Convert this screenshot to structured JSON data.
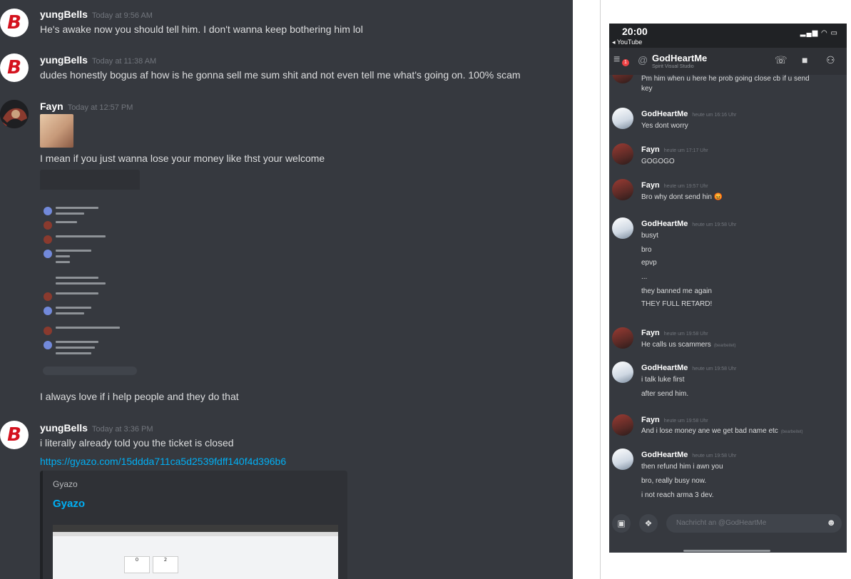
{
  "chat": {
    "messages": [
      {
        "author": "yungBells",
        "time": "Today at 9:56 AM",
        "lines": [
          "He's awake now you should tell him. I don't wanna keep bothering him lol"
        ]
      },
      {
        "author": "yungBells",
        "time": "Today at 11:38 AM",
        "lines": [
          "dudes honestly bogus af how is he gonna sell me sum shit and not even tell me what's going on. 100% scam"
        ]
      },
      {
        "author": "Fayn",
        "time": "Today at 12:57 PM",
        "lines": [
          "I mean if you just wanna lose your money like thst your welcome",
          "I always love if i help people and they do that"
        ]
      },
      {
        "author": "yungBells",
        "time": "Today at 3:36 PM",
        "lines": [
          "i literally already told you the ticket is closed"
        ],
        "link": "https://gyazo.com/15ddda711ca5d2539fdff140f4d396b6"
      }
    ],
    "embed": {
      "provider": "Gyazo",
      "title": "Gyazo",
      "card1": "0",
      "card2": "2"
    }
  },
  "phone": {
    "time": "20:00",
    "back_app": "◂ YouTube",
    "signal": "▂▄▆ ◠ ▭",
    "channel": "GodHeartMe",
    "status_sub": "Spirit Visual Studio",
    "badge": "1",
    "at": "@",
    "input_placeholder": "Nachricht an @GodHeartMe",
    "top_clip": [
      "Pm him when u here he prob going close cb if u send",
      "key"
    ],
    "messages": [
      {
        "author": "GodHeartMe",
        "time": "heute um 16:16 Uhr",
        "lines": [
          "Yes dont worry"
        ]
      },
      {
        "author": "Fayn",
        "time": "heute um 17:17 Uhr",
        "lines": [
          "GOGOGO"
        ]
      },
      {
        "author": "Fayn",
        "time": "heute um 19:57 Uhr",
        "lines": [
          "Bro why dont send hin 😡"
        ]
      },
      {
        "author": "GodHeartMe",
        "time": "heute um 19:58 Uhr",
        "lines": [
          "busyt",
          "bro",
          "epvp",
          "...",
          "they banned me again",
          "THEY FULL RETARD!"
        ]
      },
      {
        "author": "Fayn",
        "time": "heute um 19:58 Uhr",
        "lines": [
          "He calls us scammers"
        ],
        "edited": "(bearbeitet)"
      },
      {
        "author": "GodHeartMe",
        "time": "heute um 19:58 Uhr",
        "lines": [
          "i talk luke first",
          "after send him."
        ]
      },
      {
        "author": "Fayn",
        "time": "heute um 19:58 Uhr",
        "lines": [
          "And i lose money ane we get bad name etc"
        ],
        "edited": "(bearbeitet)"
      },
      {
        "author": "GodHeartMe",
        "time": "heute um 19:58 Uhr",
        "lines": [
          "then refund him i awn you",
          "bro, really busy now.",
          "i not reach arma 3 dev."
        ]
      }
    ]
  }
}
